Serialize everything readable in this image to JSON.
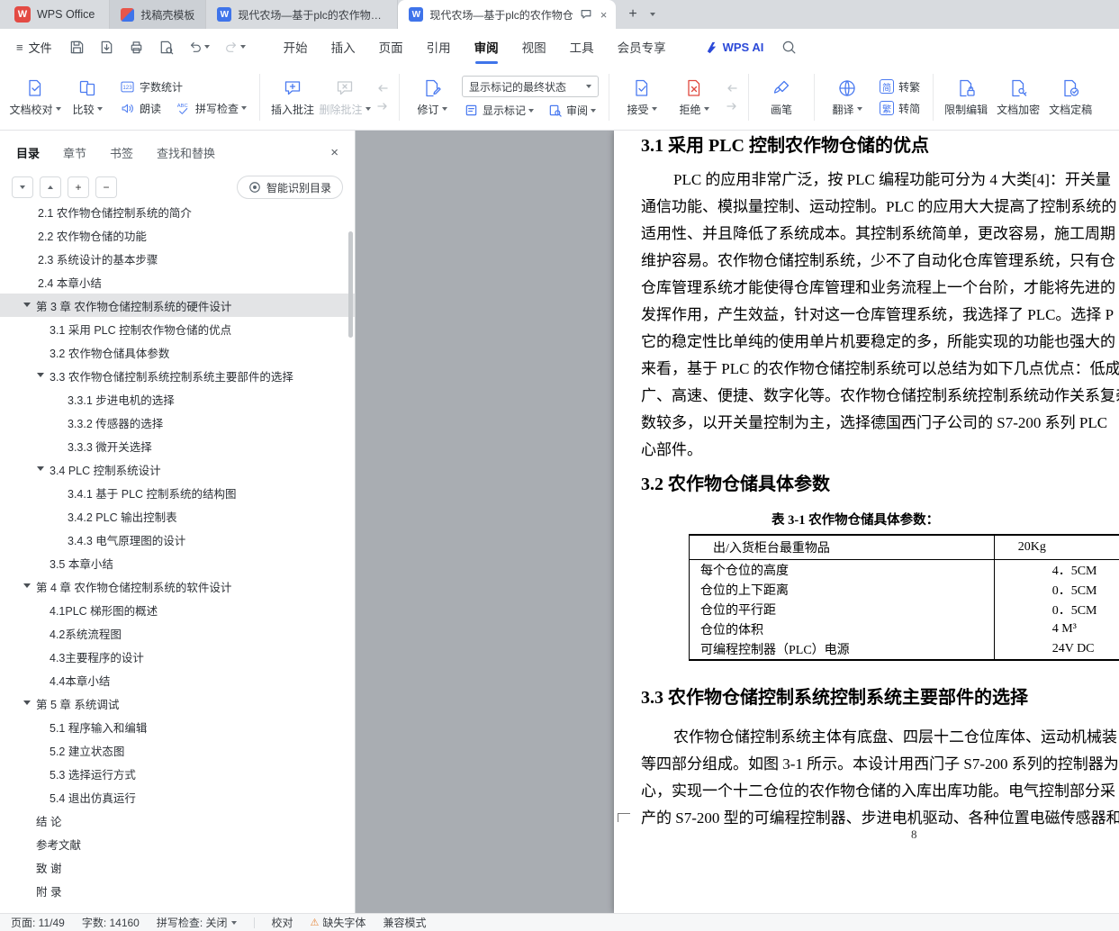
{
  "tabbar": {
    "launcher": "WPS Office",
    "tabs": [
      {
        "label": "找稿壳模板",
        "type": "home",
        "active": false
      },
      {
        "label": "现代农场—基于plc的农作物仓储控制",
        "type": "doc",
        "active": false
      },
      {
        "label": "现代农场—基于plc的农作物仓",
        "type": "doc",
        "active": true
      }
    ]
  },
  "menubar": {
    "file_label": "文件",
    "items": [
      "开始",
      "插入",
      "页面",
      "引用",
      "审阅",
      "视图",
      "工具",
      "会员专享"
    ],
    "active": "审阅",
    "ai_label": "WPS AI"
  },
  "ribbon": {
    "doc_proof": "文档校对",
    "compare": "比较",
    "word_count": "字数统计",
    "read_aloud": "朗读",
    "spell_check": "拼写检查",
    "insert_comment": "插入批注",
    "delete_comment": "删除批注",
    "track_changes": "修订",
    "markup_state": "显示标记的最终状态",
    "show_markup": "显示标记",
    "review": "审阅",
    "accept": "接受",
    "reject": "拒绝",
    "pen": "画笔",
    "translate": "翻译",
    "s2t_icon": "简",
    "s2t": "转繁",
    "t2s_icon": "繁",
    "t2s": "转简",
    "restrict_edit": "限制编辑",
    "encrypt": "文档加密",
    "finalize": "文档定稿"
  },
  "sidebar": {
    "tabs": [
      "目录",
      "章节",
      "书签",
      "查找和替换"
    ],
    "active_tab": "目录",
    "smart_toc": "智能识别目录",
    "toc": [
      {
        "label": "2.1 农作物仓储控制系统的简介",
        "indent": 42
      },
      {
        "label": "2.2 农作物仓储的功能",
        "indent": 42
      },
      {
        "label": "2.3 系统设计的基本步骤",
        "indent": 42
      },
      {
        "label": "2.4 本章小结",
        "indent": 42
      },
      {
        "label": "第 3 章 农作物仓储控制系统的硬件设计",
        "indent": 40,
        "caret": true,
        "selected": true
      },
      {
        "label": "3.1 采用 PLC 控制农作物仓储的优点",
        "indent": 55
      },
      {
        "label": "3.2 农作物仓储具体参数",
        "indent": 55
      },
      {
        "label": "3.3 农作物仓储控制系统控制系统主要部件的选择",
        "indent": 55,
        "caret": true
      },
      {
        "label": "3.3.1 步进电机的选择",
        "indent": 75
      },
      {
        "label": "3.3.2 传感器的选择",
        "indent": 75
      },
      {
        "label": "3.3.3 微开关选择",
        "indent": 75
      },
      {
        "label": "3.4 PLC 控制系统设计",
        "indent": 55,
        "caret": true
      },
      {
        "label": "3.4.1 基于 PLC 控制系统的结构图",
        "indent": 75
      },
      {
        "label": "3.4.2 PLC 输出控制表",
        "indent": 75
      },
      {
        "label": "3.4.3 电气原理图的设计",
        "indent": 75
      },
      {
        "label": "3.5 本章小结",
        "indent": 55
      },
      {
        "label": "第 4 章 农作物仓储控制系统的软件设计",
        "indent": 40,
        "caret": true
      },
      {
        "label": "4.1PLC 梯形图的概述",
        "indent": 55
      },
      {
        "label": "4.2系统流程图",
        "indent": 55
      },
      {
        "label": "4.3主要程序的设计",
        "indent": 55
      },
      {
        "label": "4.4本章小结",
        "indent": 55
      },
      {
        "label": "第 5 章 系统调试",
        "indent": 40,
        "caret": true
      },
      {
        "label": "5.1 程序输入和编辑",
        "indent": 55
      },
      {
        "label": "5.2 建立状态图",
        "indent": 55
      },
      {
        "label": "5.3 选择运行方式",
        "indent": 55
      },
      {
        "label": "5.4 退出仿真运行",
        "indent": 55
      },
      {
        "label": "结 论",
        "indent": 40
      },
      {
        "label": "参考文献",
        "indent": 40
      },
      {
        "label": "致 谢",
        "indent": 40
      },
      {
        "label": "附 录",
        "indent": 40
      }
    ]
  },
  "document": {
    "sections": [
      {
        "heading": "3.1 采用 PLC 控制农作物仓储的优点",
        "lines": [
          "PLC 的应用非常广泛，按 PLC 编程功能可分为 4 大类[4]：开关量",
          "通信功能、模拟量控制、运动控制。PLC 的应用大大提高了控制系统的",
          "适用性、并且降低了系统成本。其控制系统简单，更改容易，施工周期",
          "维护容易。农作物仓储控制系统，少不了自动化仓库管理系统，只有仓",
          "仓库管理系统才能使得仓库管理和业务流程上一个台阶，才能将先进的",
          "发挥作用，产生效益，针对这一仓库管理系统，我选择了 PLC。选择 P",
          "它的稳定性比单纯的使用单片机要稳定的多，所能实现的功能也强大的",
          "来看，基于 PLC 的农作物仓储控制系统可以总结为如下几点优点：低成",
          "广、高速、便捷、数字化等。农作物仓储控制系统控制系统动作关系复杂",
          "数较多，以开关量控制为主，选择德国西门子公司的 S7-200 系列 PLC",
          "心部件。"
        ]
      },
      {
        "heading": "3.2 农作物仓储具体参数",
        "table_caption": "表 3-1 农作物仓储具体参数：",
        "table": {
          "rows": [
            [
              "出/入货柜台最重物品",
              "20Kg"
            ],
            [
              "每个仓位的高度",
              "4．5CM"
            ],
            [
              "仓位的上下距离",
              "0．5CM"
            ],
            [
              "仓位的平行距",
              "0．5CM"
            ],
            [
              "仓位的体积",
              "4 M³"
            ],
            [
              "可编程控制器（PLC）电源",
              "24V DC"
            ]
          ]
        }
      },
      {
        "heading": "3.3 农作物仓储控制系统控制系统主要部件的选择",
        "lines": [
          "农作物仓储控制系统主体有底盘、四层十二仓位库体、运动机械装",
          "等四部分组成。如图 3-1 所示。本设计用西门子 S7-200 系列的控制器为",
          "心，实现一个十二仓位的农作物仓储的入库出库功能。电气控制部分采",
          "产的 S7-200 型的可编程控制器、步进电机驱动、各种位置电磁传感器和"
        ]
      }
    ],
    "page_number": "8"
  },
  "statusbar": {
    "page": "页面: 11/49",
    "words": "字数: 14160",
    "spell": "拼写检查: 关闭",
    "proof": "校对",
    "missing_font": "缺失字体",
    "compat": "兼容模式"
  }
}
